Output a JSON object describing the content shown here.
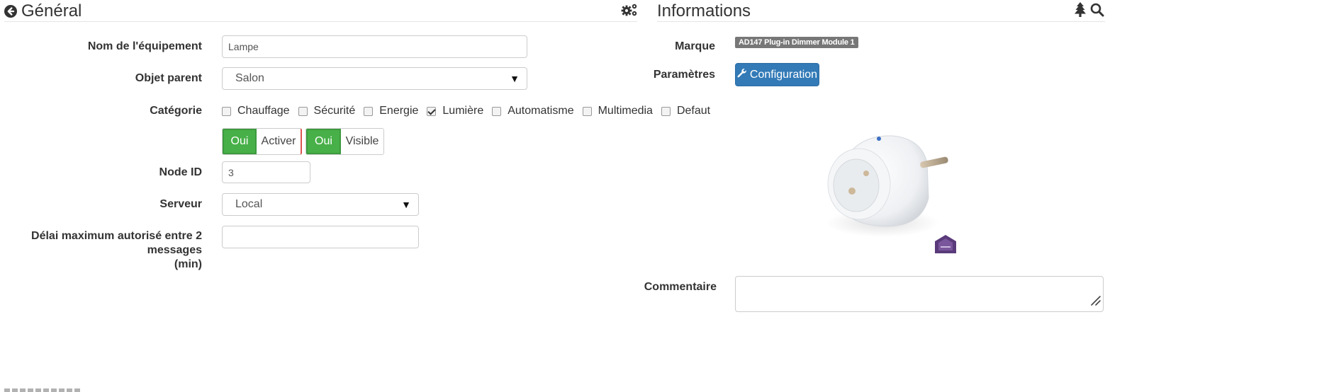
{
  "general": {
    "title": "Général",
    "fields": {
      "name_label": "Nom de l'équipement",
      "name_value": "Lampe",
      "parent_label": "Objet parent",
      "parent_value": "Salon",
      "category_label": "Catégorie",
      "categories": [
        {
          "label": "Chauffage",
          "checked": false
        },
        {
          "label": "Sécurité",
          "checked": false
        },
        {
          "label": "Energie",
          "checked": false
        },
        {
          "label": "Lumière",
          "checked": true
        },
        {
          "label": "Automatisme",
          "checked": false
        },
        {
          "label": "Multimedia",
          "checked": false
        },
        {
          "label": "Defaut",
          "checked": false
        }
      ],
      "toggle_activate_on": "Oui",
      "toggle_activate_label": "Activer",
      "toggle_visible_on": "Oui",
      "toggle_visible_label": "Visible",
      "node_id_label": "Node ID",
      "node_id_value": "3",
      "server_label": "Serveur",
      "server_value": "Local",
      "delay_label_line1": "Délai maximum autorisé entre 2 messages",
      "delay_label_line2": "(min)",
      "delay_value": ""
    }
  },
  "info": {
    "title": "Informations",
    "brand_label": "Marque",
    "brand_value": "AD147 Plug-in Dimmer Module 1",
    "params_label": "Paramètres",
    "config_button": "Configuration",
    "comment_label": "Commentaire",
    "comment_value": ""
  },
  "icons": {
    "back": "circle-arrow-left-icon",
    "settings": "cogs-icon",
    "tree": "tree-icon",
    "search": "search-icon",
    "wrench": "wrench-icon"
  },
  "colors": {
    "toggle_on": "#47b048",
    "primary": "#337ab7",
    "badge": "#777777"
  }
}
